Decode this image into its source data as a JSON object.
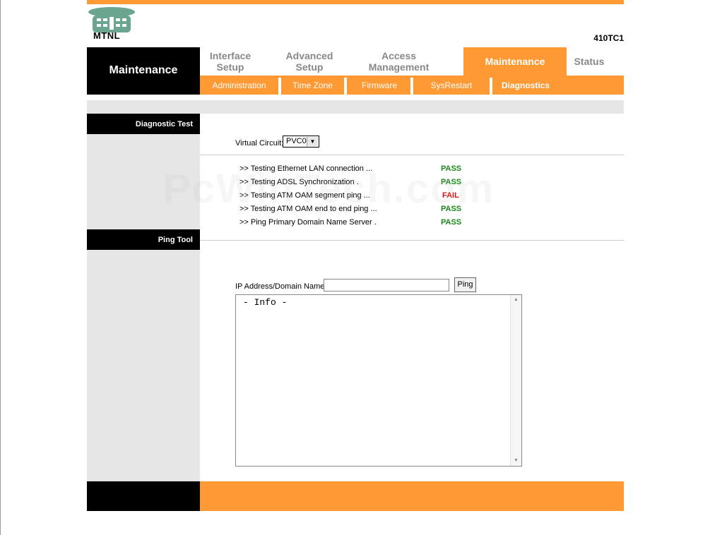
{
  "brand": {
    "logo_text": "MTNL",
    "model": "410TC1",
    "accent_color": "#ff9933"
  },
  "nav": {
    "section_title": "Maintenance",
    "tabs": [
      {
        "label": "Interface\nSetup"
      },
      {
        "label": "Advanced\nSetup"
      },
      {
        "label": "Access\nManagement"
      },
      {
        "label": "Maintenance",
        "active": true
      },
      {
        "label": "Status"
      }
    ],
    "subtabs": [
      {
        "label": "Administration"
      },
      {
        "label": "Time Zone"
      },
      {
        "label": "Firmware"
      },
      {
        "label": "SysRestart"
      },
      {
        "label": "Diagnostics",
        "active": true
      }
    ]
  },
  "diagnostic": {
    "section_label": "Diagnostic Test",
    "vc_label": "Virtual Circuit:",
    "vc_value": "PVC0",
    "tests": [
      {
        "label": ">> Testing Ethernet LAN connection ...",
        "result": "PASS"
      },
      {
        "label": ">> Testing ADSL Synchronization .",
        "result": "PASS"
      },
      {
        "label": ">> Testing ATM OAM segment ping ...",
        "result": "FAIL"
      },
      {
        "label": ">> Testing ATM OAM end to end ping ...",
        "result": "PASS"
      },
      {
        "label": ">> Ping Primary Domain Name Server .",
        "result": "PASS"
      }
    ]
  },
  "ping": {
    "section_label": "Ping Tool",
    "ip_label": "IP Address/Domain Name:",
    "ip_value": "",
    "button_label": "Ping",
    "info_text": "- Info -"
  },
  "watermark": "PcWinTech.com"
}
